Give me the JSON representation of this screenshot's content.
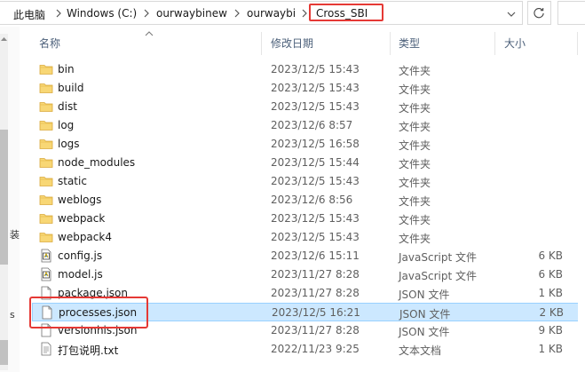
{
  "address_bar": {
    "crumbs": [
      "此电脑",
      "Windows (C:)",
      "ourwaybinew",
      "ourwaybi",
      "Cross_SBI"
    ]
  },
  "nav_side_marks": [
    "装",
    "s"
  ],
  "columns": {
    "name": "名称",
    "date": "修改日期",
    "type": "类型",
    "size": "大小"
  },
  "files": [
    {
      "name": "bin",
      "date": "2023/12/5 15:43",
      "type": "文件夹",
      "size": "",
      "icon": "folder-icon"
    },
    {
      "name": "build",
      "date": "2023/12/5 15:43",
      "type": "文件夹",
      "size": "",
      "icon": "folder-icon"
    },
    {
      "name": "dist",
      "date": "2023/12/5 15:43",
      "type": "文件夹",
      "size": "",
      "icon": "folder-icon"
    },
    {
      "name": "log",
      "date": "2023/12/6 8:57",
      "type": "文件夹",
      "size": "",
      "icon": "folder-icon"
    },
    {
      "name": "logs",
      "date": "2023/12/5 16:58",
      "type": "文件夹",
      "size": "",
      "icon": "folder-icon"
    },
    {
      "name": "node_modules",
      "date": "2023/12/5 15:44",
      "type": "文件夹",
      "size": "",
      "icon": "folder-icon"
    },
    {
      "name": "static",
      "date": "2023/12/5 15:43",
      "type": "文件夹",
      "size": "",
      "icon": "folder-icon"
    },
    {
      "name": "weblogs",
      "date": "2023/12/6 8:56",
      "type": "文件夹",
      "size": "",
      "icon": "folder-icon"
    },
    {
      "name": "webpack",
      "date": "2023/12/5 15:43",
      "type": "文件夹",
      "size": "",
      "icon": "folder-icon"
    },
    {
      "name": "webpack4",
      "date": "2023/12/5 15:43",
      "type": "文件夹",
      "size": "",
      "icon": "folder-icon"
    },
    {
      "name": "config.js",
      "date": "2023/12/6 15:11",
      "type": "JavaScript 文件",
      "size": "6 KB",
      "icon": "javascript-file-icon"
    },
    {
      "name": "model.js",
      "date": "2023/11/27 8:28",
      "type": "JavaScript 文件",
      "size": "6 KB",
      "icon": "javascript-file-icon"
    },
    {
      "name": "package.json",
      "date": "2023/11/27 8:28",
      "type": "JSON 文件",
      "size": "1 KB",
      "icon": "json-file-icon"
    },
    {
      "name": "processes.json",
      "date": "2023/12/5 16:21",
      "type": "JSON 文件",
      "size": "2 KB",
      "icon": "json-file-icon",
      "selected": true
    },
    {
      "name": "versionhis.json",
      "date": "2023/11/27 8:28",
      "type": "JSON 文件",
      "size": "9 KB",
      "icon": "json-file-icon"
    },
    {
      "name": "打包说明.txt",
      "date": "2022/11/23 9:25",
      "type": "文本文档",
      "size": "1 KB",
      "icon": "text-file-icon"
    }
  ],
  "colors": {
    "selection_bg": "#cce8ff",
    "selection_border": "#99d1ff",
    "annotation_red": "#e53935",
    "folder_yellow": "#f8d775"
  }
}
